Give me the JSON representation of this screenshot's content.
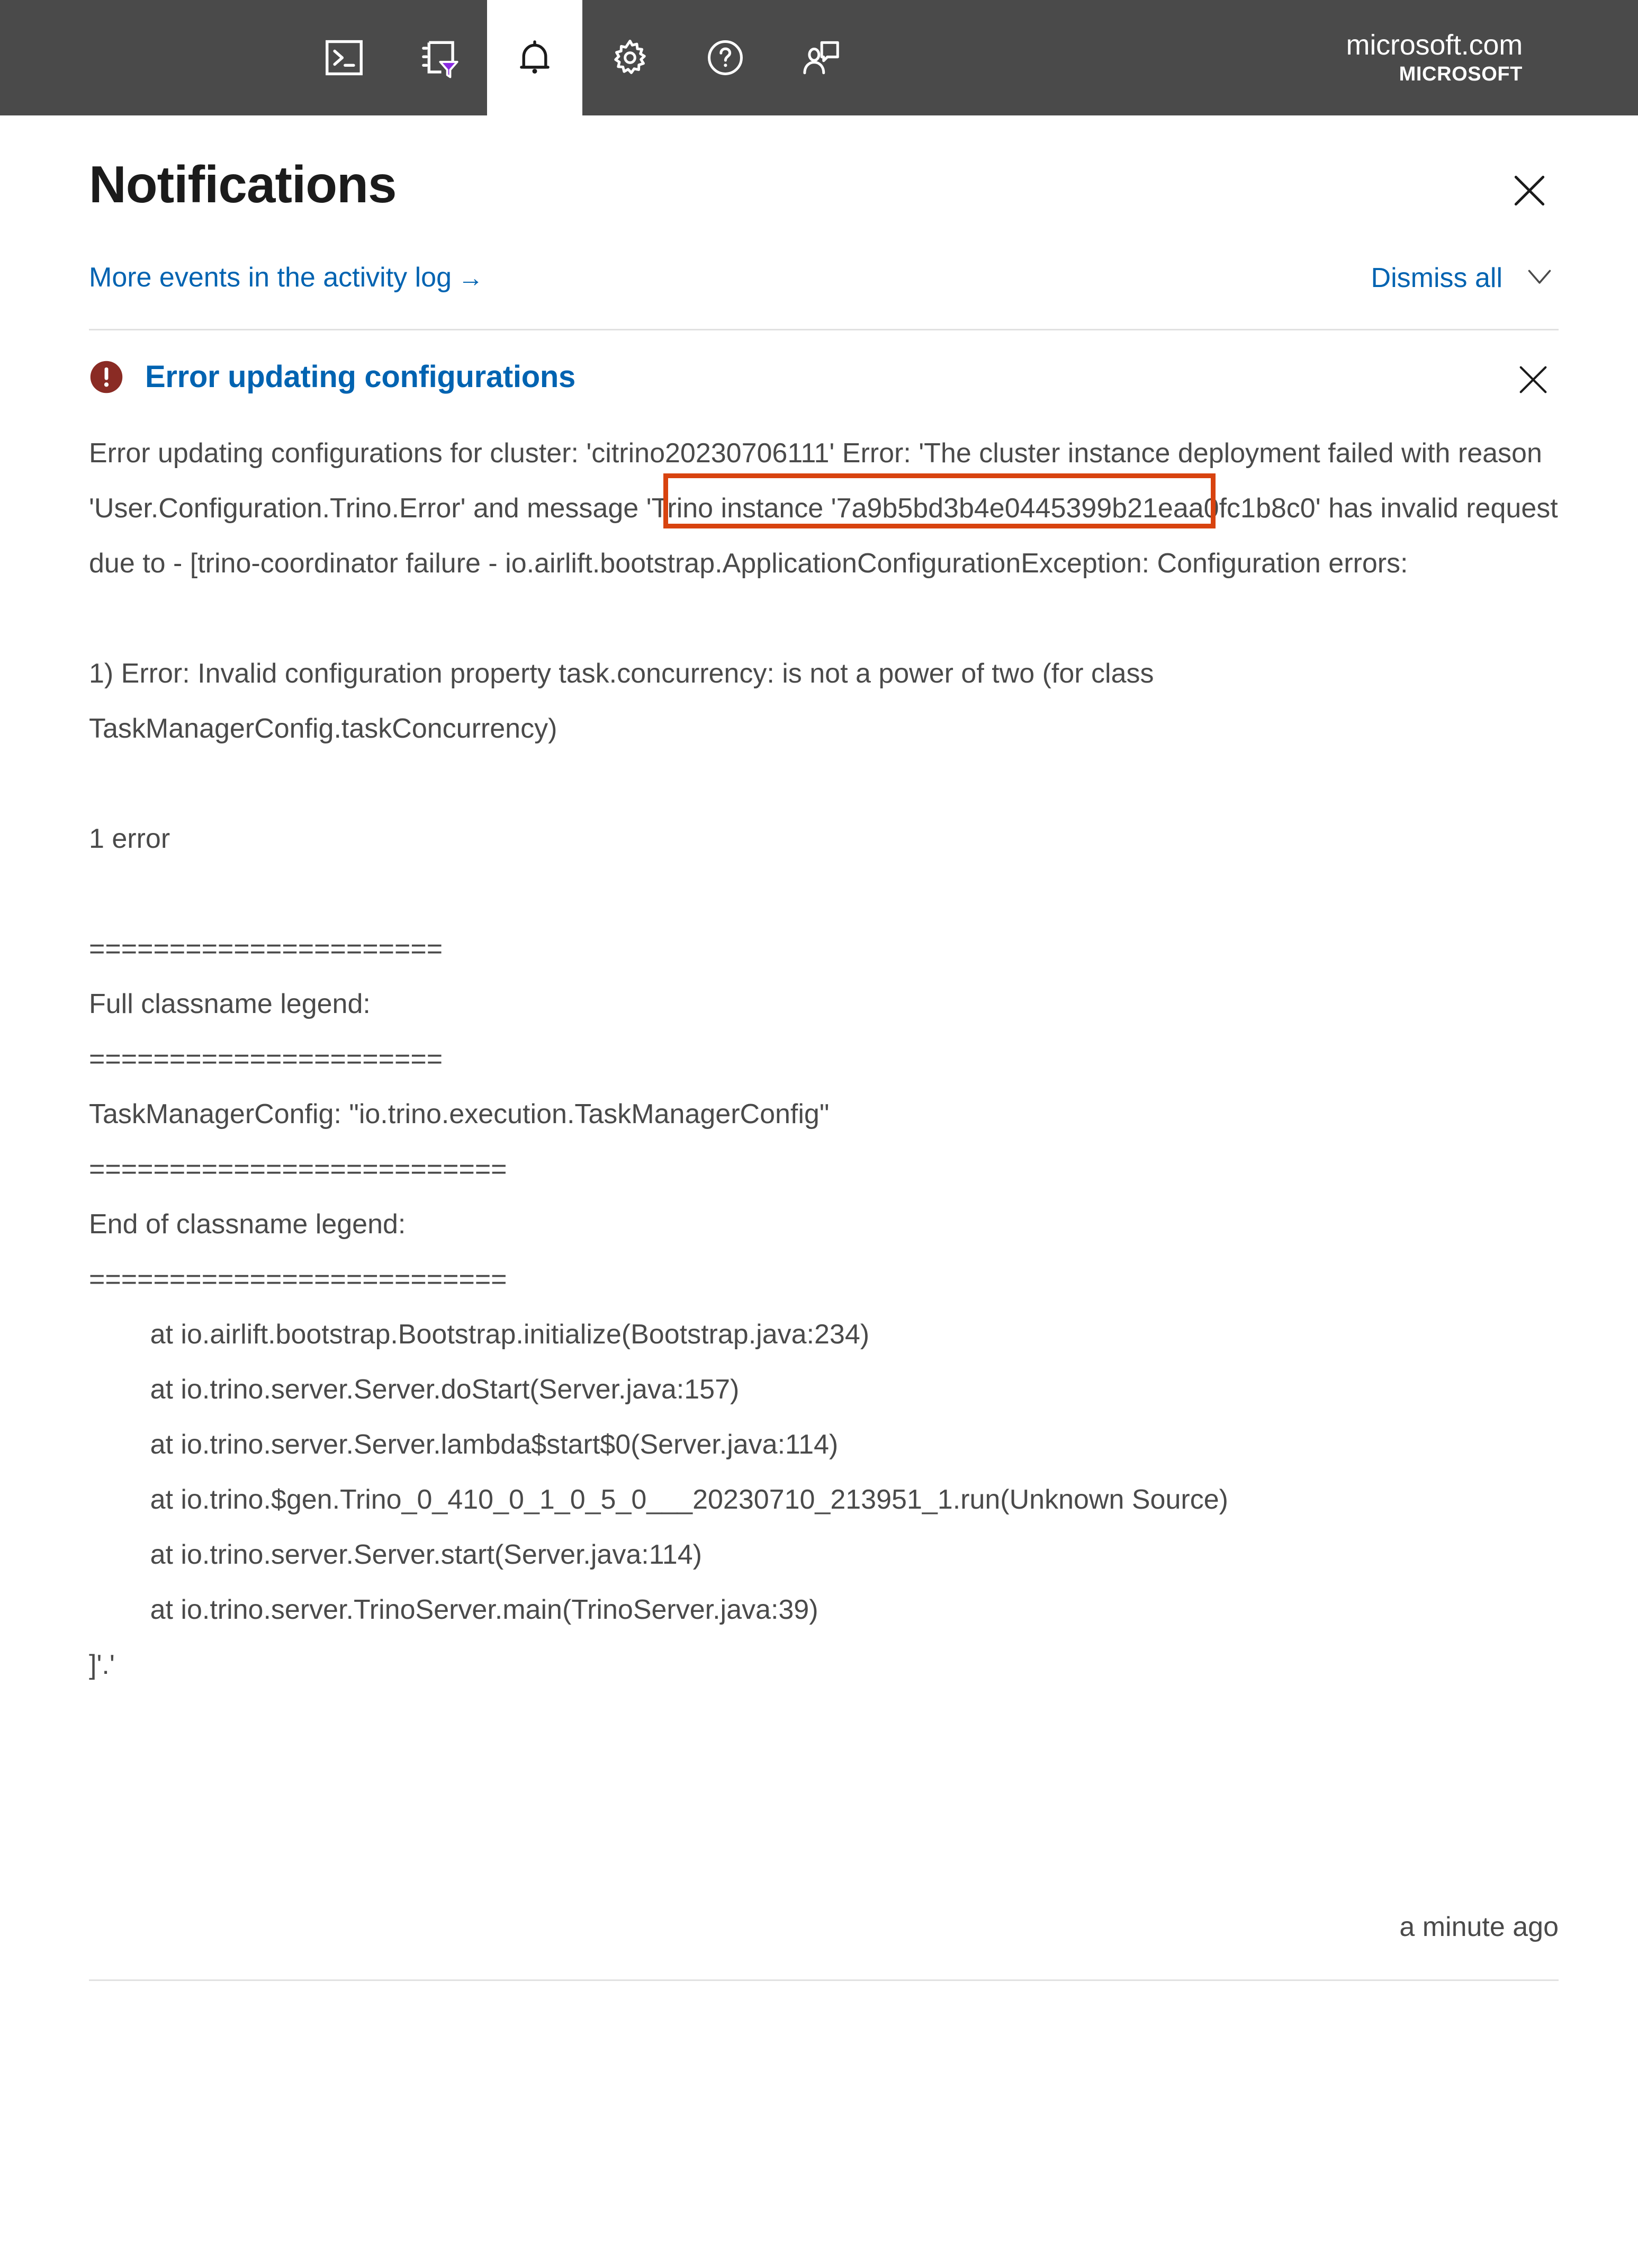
{
  "topbar": {
    "icons_left": [
      {
        "name": "cloud-shell-icon",
        "label": "Cloud Shell"
      },
      {
        "name": "directory-filter-icon",
        "label": "Directories + subscriptions"
      },
      {
        "name": "notifications-bell-icon",
        "label": "Notifications"
      }
    ],
    "icons_right": [
      {
        "name": "settings-gear-icon",
        "label": "Settings"
      },
      {
        "name": "help-question-icon",
        "label": "Help"
      },
      {
        "name": "feedback-person-icon",
        "label": "Feedback"
      }
    ],
    "brand": {
      "domain": "microsoft.com",
      "org": "MICROSOFT"
    }
  },
  "panel": {
    "title": "Notifications",
    "close_label": "Close",
    "more_events_link": "More events in the activity log",
    "more_events_arrow": "→",
    "dismiss_all": "Dismiss all"
  },
  "notification": {
    "icon": "error-circle-icon",
    "title": "Error updating configurations",
    "close_label": "Dismiss",
    "timestamp": "a minute ago",
    "highlighted_token": "'User.Configuration.Trino.Error'",
    "body_part_1": "Error updating configurations for cluster: 'citrino20230706111' Error: 'The cluster instance deployment failed with reason 'User.Configuration.Trino.Error' and message 'Trino instance '7a9b5bd3b4e0445399b21eaa0fc1b8c0' has invalid request due to - [trino-coordinator failure - io.airlift.bootstrap.ApplicationConfigurationException: Configuration errors:\n\n1) Error: Invalid configuration property task.concurrency: is not a power of two (for class TaskManagerConfig.taskConcurrency)\n\n1 error\n\n",
    "rule_1": "======================",
    "legend_header": "Full classname legend:",
    "rule_2": "======================",
    "legend_entry": "TaskManagerConfig: \"io.trino.execution.TaskManagerConfig\"",
    "rule_3": "==========================",
    "legend_footer": "End of classname legend:",
    "rule_4": "==========================",
    "stack_trace": "\n\tat io.airlift.bootstrap.Bootstrap.initialize(Bootstrap.java:234)\n\tat io.trino.server.Server.doStart(Server.java:157)\n\tat io.trino.server.Server.lambda$start$0(Server.java:114)\n\tat io.trino.$gen.Trino_0_410_0_1_0_5_0___20230710_213951_1.run(Unknown Source)\n\tat io.trino.server.Server.start(Server.java:114)\n\tat io.trino.server.TrinoServer.main(TrinoServer.java:39)\n",
    "body_tail": "]'.'"
  },
  "colors": {
    "topbar_bg": "#4a4a4a",
    "link_blue": "#0063b1",
    "error_red": "#8a2b24",
    "highlight_orange": "#d8430f",
    "body_text": "#4a4a4a",
    "title_text": "#1b1b1b"
  }
}
